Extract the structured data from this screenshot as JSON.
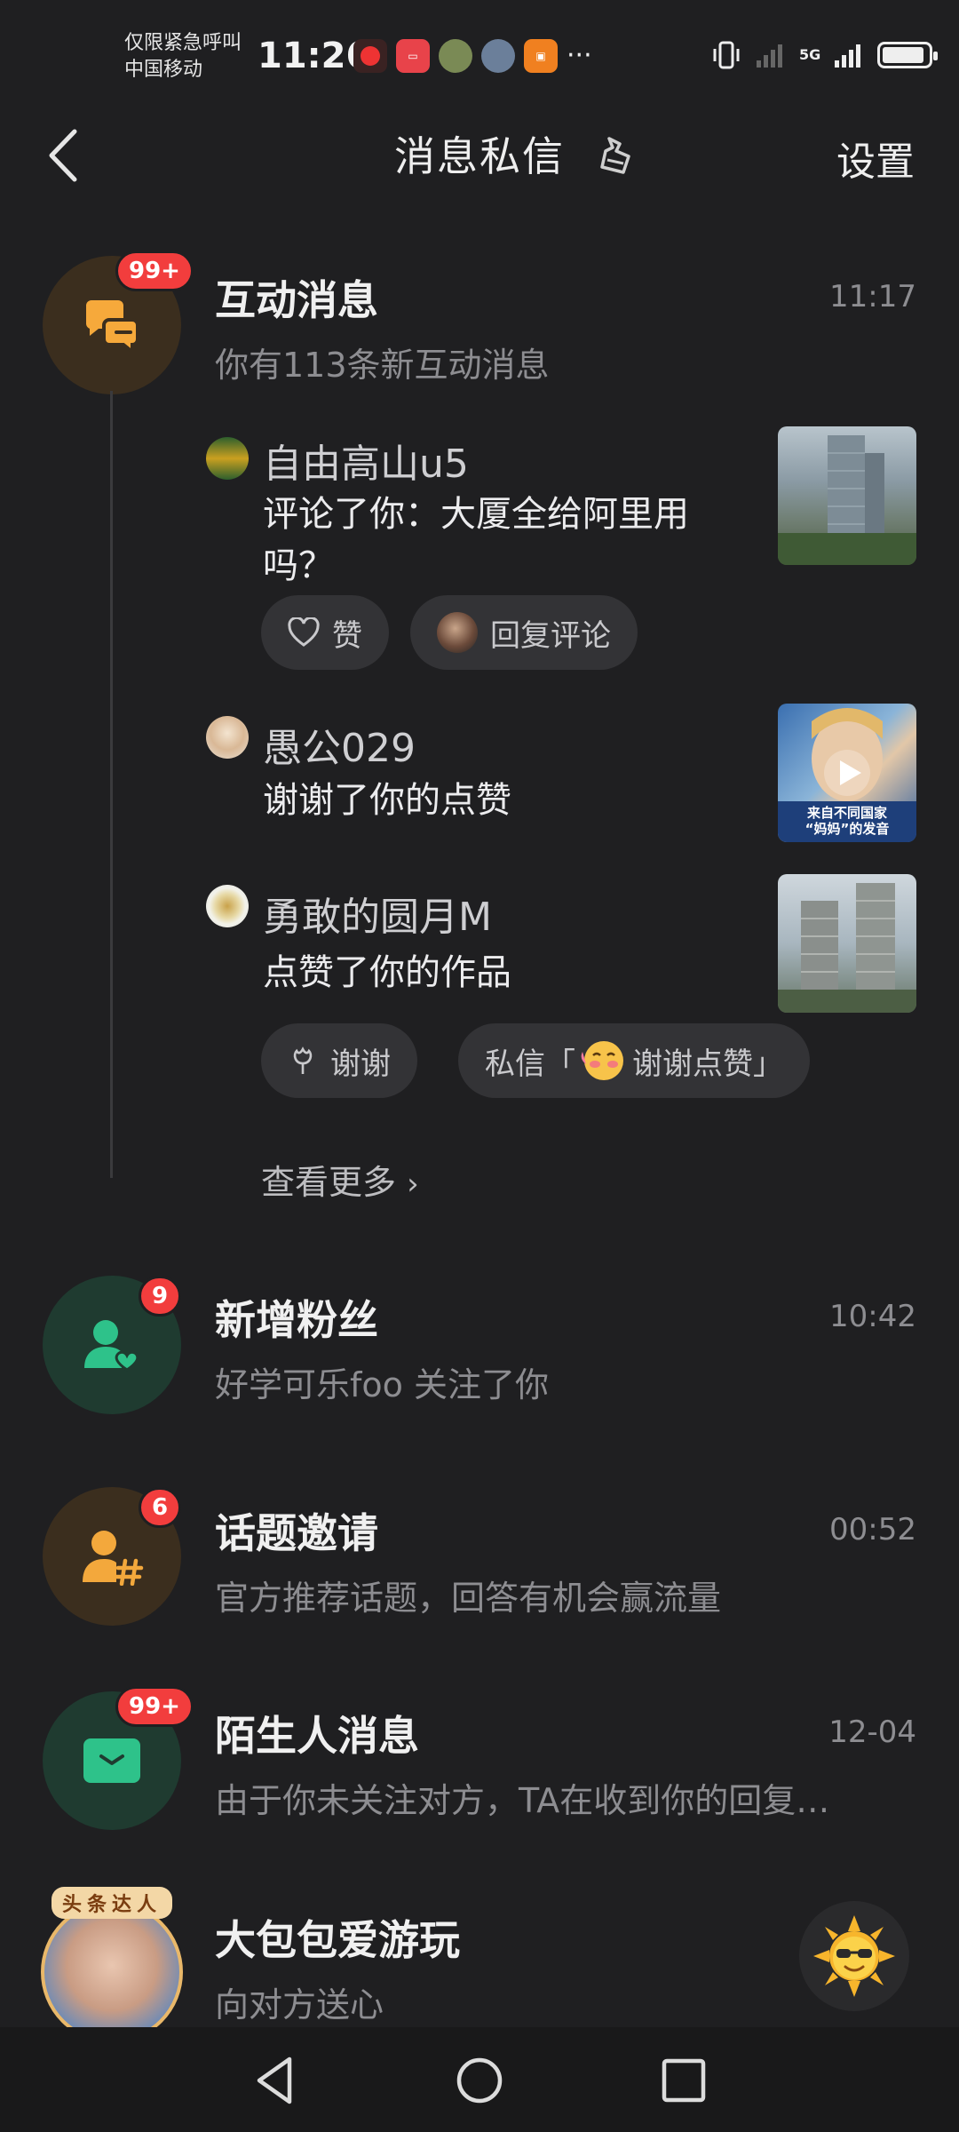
{
  "status_bar": {
    "carrier_line1": "仅限紧急呼叫",
    "carrier_line2": "中国移动",
    "time": "11:26",
    "more": "···",
    "network": "5G"
  },
  "header": {
    "title": "消息私信",
    "settings": "设置"
  },
  "interactions": {
    "title": "互动消息",
    "subtitle": "你有113条新互动消息",
    "time": "11:17",
    "badge": "99+",
    "items": [
      {
        "name": "自由高山u5",
        "text_line1": "评论了你：大厦全给阿里用",
        "text_line2": "吗？",
        "actions": [
          "赞",
          "回复评论"
        ]
      },
      {
        "name": "愚公029",
        "text_line1": "谢谢了你的点赞",
        "thumb_caption_line1": "来自不同国家",
        "thumb_caption_line2": "“妈妈”的发音"
      },
      {
        "name": "勇敢的圆月M",
        "text_line1": "点赞了你的作品",
        "actions": [
          "谢谢",
          "私信「",
          "谢谢点赞」"
        ]
      }
    ],
    "see_more": "查看更多"
  },
  "followers": {
    "title": "新增粉丝",
    "subtitle": "好学可乐foo 关注了你",
    "time": "10:42",
    "badge": "9"
  },
  "topic_invite": {
    "title": "话题邀请",
    "subtitle": "官方推荐话题，回答有机会赢流量",
    "time": "00:52",
    "badge": "6"
  },
  "stranger": {
    "title": "陌生人消息",
    "subtitle": "由于你未关注对方，TA在收到你的回复…",
    "time": "12-04",
    "badge": "99+"
  },
  "chat": {
    "title": "大包包爱游玩",
    "subtitle": "向对方送心",
    "avatar_banner": "头条达人"
  },
  "colors": {
    "background": "#1f1f21",
    "badge_red": "#f23d3d",
    "interaction_orange": "#f6a93b",
    "followers_green": "#2ec28a",
    "topic_orange": "#f3a83c"
  }
}
